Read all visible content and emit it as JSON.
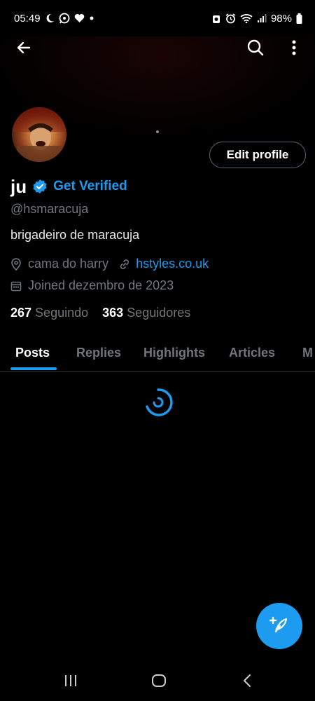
{
  "status_bar": {
    "time": "05:49",
    "battery": "98%",
    "left_icons": [
      "moon-icon",
      "whatsapp-icon",
      "heart-icon",
      "dot-icon"
    ],
    "right_icons": [
      "alarm-icon",
      "alarm-clock-icon",
      "wifi-icon",
      "signal-icon",
      "battery-icon"
    ]
  },
  "top_bar": {
    "back_icon": "arrow-left-icon",
    "search_icon": "search-icon",
    "more_icon": "more-vertical-icon"
  },
  "profile": {
    "name": "ju",
    "get_verified": "Get Verified",
    "handle": "@hsmaracuja",
    "bio": "brigadeiro de maracuja",
    "location": "cama do harry",
    "website": "hstyles.co.uk",
    "joined": "Joined dezembro de 2023",
    "following_count": "267",
    "following_label": "Seguindo",
    "followers_count": "363",
    "followers_label": "Seguidores",
    "edit_button": "Edit profile"
  },
  "tabs": [
    {
      "label": "Posts",
      "active": true
    },
    {
      "label": "Replies",
      "active": false
    },
    {
      "label": "Highlights",
      "active": false
    },
    {
      "label": "Articles",
      "active": false
    },
    {
      "label": "M",
      "active": false
    }
  ],
  "colors": {
    "accent": "#1d9bf0",
    "background": "#000000",
    "text_primary": "#e7e9ea",
    "text_secondary": "#71767b"
  },
  "fab": {
    "icon": "compose-post-icon"
  },
  "nav_bar": {
    "icons": [
      "recent-apps-icon",
      "home-icon",
      "back-icon"
    ]
  }
}
